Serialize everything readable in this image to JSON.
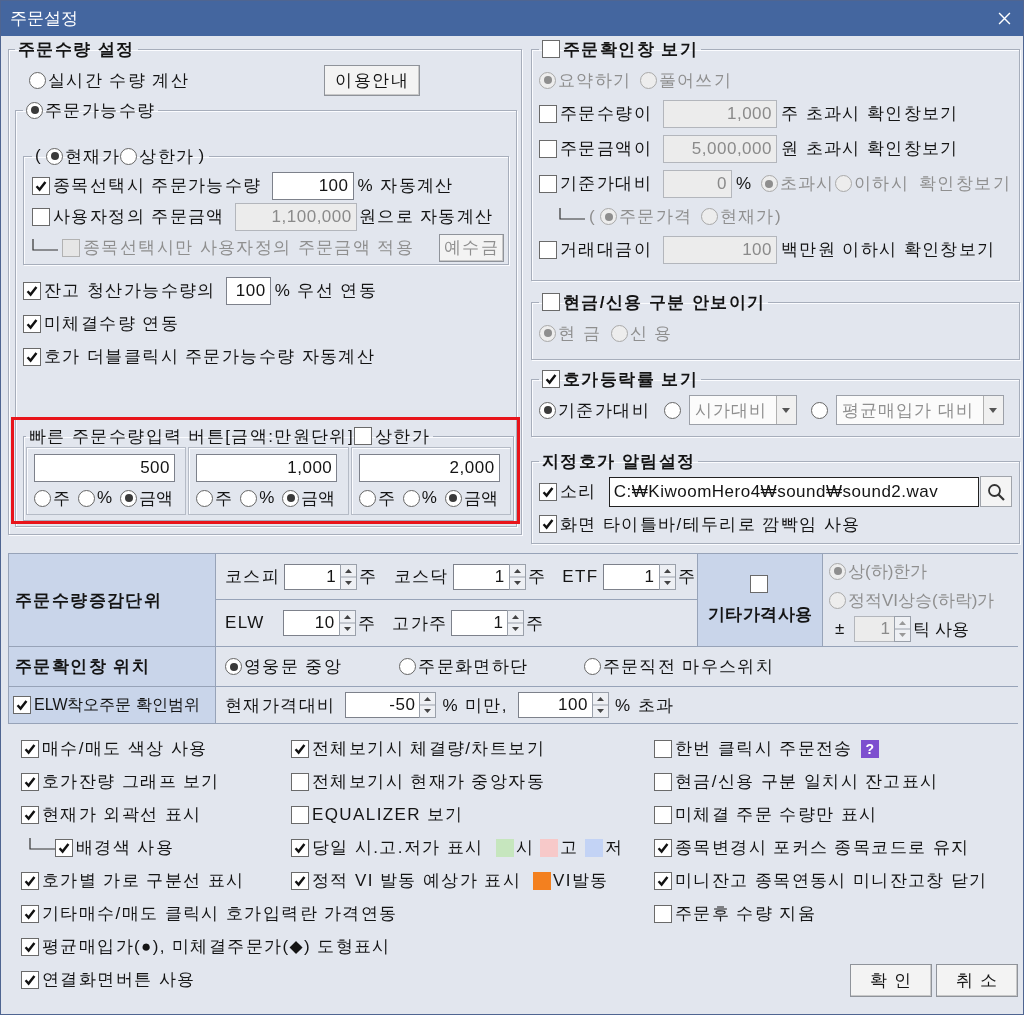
{
  "window": {
    "title": "주문설정"
  },
  "order_qty": {
    "legend": "주문수량 설정",
    "realtime": {
      "label": "실시간 수량 계산",
      "selected": false
    },
    "guide_button": "이용안내",
    "available": {
      "label": "주문가능수량",
      "selected": true
    },
    "basis": {
      "open": "(",
      "close": ")",
      "options": [
        {
          "label": "현재가",
          "selected": true
        },
        {
          "label": "상한가",
          "selected": false
        }
      ]
    },
    "on_select": {
      "label": "종목선택시 주문가능수량",
      "checked": true,
      "value": "100",
      "suffix": "% 자동계산"
    },
    "custom_amount": {
      "label": "사용자정의 주문금액",
      "checked": false,
      "value": "1,100,000",
      "disabled": true,
      "suffix": "원으로 자동계산"
    },
    "custom_only": {
      "label": "종목선택시만 사용자정의 주문금액 적용",
      "checked": false,
      "disabled": true,
      "button": "예수금"
    },
    "balance": {
      "label": "잔고 청산가능수량의",
      "checked": true,
      "value": "100",
      "suffix": "% 우선 연동"
    },
    "unfilled": {
      "label": "미체결수량 연동",
      "checked": true
    },
    "dblclick": {
      "label": "호가 더블클릭시 주문가능수량 자동계산",
      "checked": true
    },
    "quick": {
      "highlighted": true,
      "legend": "빠른 주문수량입력 버튼[금액:만원단위]",
      "upper": {
        "label": "상한가",
        "checked": false
      },
      "slots": [
        {
          "value": "500",
          "units": [
            {
              "label": "주",
              "selected": false
            },
            {
              "label": "%",
              "selected": false
            },
            {
              "label": "금액",
              "selected": true
            }
          ]
        },
        {
          "value": "1,000",
          "units": [
            {
              "label": "주",
              "selected": false
            },
            {
              "label": "%",
              "selected": false
            },
            {
              "label": "금액",
              "selected": true
            }
          ]
        },
        {
          "value": "2,000",
          "units": [
            {
              "label": "주",
              "selected": false
            },
            {
              "label": "%",
              "selected": false
            },
            {
              "label": "금액",
              "selected": true
            }
          ]
        }
      ]
    }
  },
  "confirm": {
    "legend": {
      "label": "주문확인창 보기",
      "checked": false
    },
    "disabled": true,
    "style": [
      {
        "label": "요약하기",
        "selected": true
      },
      {
        "label": "풀어쓰기",
        "selected": false
      }
    ],
    "qty": {
      "label": "주문수량이",
      "checked": false,
      "value": "1,000",
      "suffix": "주 초과시 확인창보기"
    },
    "amount": {
      "label": "주문금액이",
      "checked": false,
      "value": "5,000,000",
      "suffix": "원 초과시 확인창보기"
    },
    "base": {
      "label": "기준가대비",
      "checked": false,
      "value": "0",
      "suffix": "%",
      "when": [
        {
          "label": "초과시",
          "selected": true
        },
        {
          "label": "이하시",
          "selected": false
        }
      ],
      "tail": "확인창보기",
      "ref": {
        "open": "(",
        "close": ")",
        "options": [
          {
            "label": "주문가격",
            "selected": true
          },
          {
            "label": "현재가",
            "selected": false
          }
        ]
      }
    },
    "turnover": {
      "label": "거래대금이",
      "checked": false,
      "value": "100",
      "suffix": "백만원 이하시 확인창보기"
    }
  },
  "cash_credit": {
    "legend": {
      "label": "현금/신용 구분 안보이기",
      "checked": false
    },
    "disabled": true,
    "options": [
      {
        "label": "현 금",
        "selected": true
      },
      {
        "label": "신 용",
        "selected": false
      }
    ]
  },
  "change_rate": {
    "legend": {
      "label": "호가등락률 보기",
      "checked": true
    },
    "options": [
      {
        "label": "기준가대비",
        "selected": true
      },
      {
        "select": "시가대비",
        "selected": false
      },
      {
        "select": "평균매입가 대비",
        "selected": false
      }
    ]
  },
  "alert": {
    "legend": "지정호가 알림설정",
    "sound": {
      "label": "소리",
      "checked": true,
      "path": "C:₩KiwoomHero4₩sound₩sound2.wav"
    },
    "blink": {
      "label": "화면 타이틀바/테두리로 깜빡임 사용",
      "checked": true
    }
  },
  "table": {
    "units": {
      "header": "주문수량증감단위",
      "rows": [
        [
          {
            "label": "코스피",
            "value": "1",
            "unit": "주"
          },
          {
            "label": "코스닥",
            "value": "1",
            "unit": "주"
          },
          {
            "label": "ETF",
            "value": "1",
            "unit": "주"
          }
        ],
        [
          {
            "label": "ELW",
            "value": "10",
            "unit": "주"
          },
          {
            "label": "고가주",
            "value": "1",
            "unit": "주"
          }
        ]
      ]
    },
    "other_price": {
      "header": "기타가격사용",
      "checked": false,
      "disabled": true,
      "options": [
        {
          "label": "상(하)한가",
          "selected": true
        },
        {
          "label": "정적VI상승(하락)가",
          "selected": false
        }
      ],
      "tick": {
        "prefix": "±",
        "value": "1",
        "suffix": "틱 사용"
      }
    },
    "position": {
      "header": "주문확인창 위치",
      "options": [
        {
          "label": "영웅문 중앙",
          "selected": true
        },
        {
          "label": "주문화면하단",
          "selected": false
        },
        {
          "label": "주문직전 마우스위치",
          "selected": false
        }
      ]
    },
    "elw_range": {
      "header": "ELW착오주문 확인범위",
      "checked": true,
      "prefix": "현재가격대비",
      "low": "-50",
      "low_suffix": "% 미만,",
      "high": "100",
      "high_suffix": "% 초과"
    }
  },
  "options": {
    "columns": [
      {
        "items": [
          {
            "label": "매수/매도 색상 사용",
            "checked": true
          },
          {
            "label": "호가잔량 그래프 보기",
            "checked": true
          },
          {
            "label": "현재가 외곽선 표시",
            "checked": true,
            "children": [
              {
                "label": "배경색 사용",
                "checked": true
              }
            ]
          },
          {
            "label": "호가별 가로 구분선 표시",
            "checked": true
          },
          {
            "label": "기타매수/매도 클릭시 호가입력란 가격연동",
            "checked": true
          },
          {
            "label": "평균매입가(●), 미체결주문가(◆) 도형표시",
            "checked": true
          },
          {
            "label": "연결화면버튼 사용",
            "checked": true
          }
        ]
      },
      {
        "items": [
          {
            "label": "전체보기시 체결량/차트보기",
            "checked": true
          },
          {
            "label": "전체보기시 현재가 중앙자동",
            "checked": false
          },
          {
            "label": "EQUALIZER 보기",
            "checked": false
          },
          {
            "label": "당일 시.고.저가 표시",
            "checked": true,
            "swatches": [
              {
                "label": "시",
                "color": "#c6e6be"
              },
              {
                "label": "고",
                "color": "#f7c9c9"
              },
              {
                "label": "저",
                "color": "#c3d3f5"
              }
            ]
          },
          {
            "label": "정적 VI 발동 예상가 표시",
            "checked": true,
            "swatches": [
              {
                "label": "VI발동",
                "color": "#f3801f"
              }
            ]
          }
        ]
      },
      {
        "items": [
          {
            "label": "한번 클릭시 주문전송",
            "checked": false,
            "help": "?"
          },
          {
            "label": "현금/신용 구분 일치시 잔고표시",
            "checked": false
          },
          {
            "label": "미체결 주문 수량만 표시",
            "checked": false
          },
          {
            "label": "종목변경시 포커스 종목코드로 유지",
            "checked": true
          },
          {
            "label": "미니잔고 종목연동시 미니잔고창 닫기",
            "checked": true
          },
          {
            "label": "주문후 수량 지움",
            "checked": false
          }
        ]
      }
    ],
    "buttons": [
      "확 인",
      "취 소"
    ]
  }
}
